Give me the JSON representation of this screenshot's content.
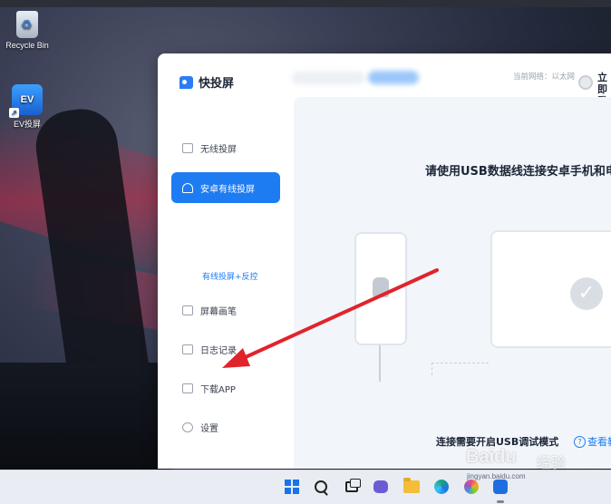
{
  "desktop": {
    "icons": [
      {
        "label": "Recycle Bin",
        "icon": "recycle-bin-icon"
      },
      {
        "label": "EV投屏",
        "icon": "ev-cast-icon"
      }
    ]
  },
  "app": {
    "logo_text": "快投屏",
    "network_label": "当前网络：以太网",
    "login_label": "立即登录",
    "sidebar": {
      "items": [
        {
          "label": "无线投屏",
          "icon": "wireless-cast-icon",
          "active": false
        },
        {
          "label": "安卓有线投屏",
          "icon": "android-icon",
          "active": true
        },
        {
          "label": "屏幕画笔",
          "icon": "pen-icon",
          "active": false
        },
        {
          "label": "日志记录",
          "icon": "log-icon",
          "active": false
        },
        {
          "label": "下载APP",
          "icon": "download-icon",
          "active": false
        },
        {
          "label": "设置",
          "icon": "gear-icon",
          "active": false
        }
      ],
      "sub_link": "有线投屏+反控"
    },
    "main": {
      "title": "请使用USB数据线连接安卓手机和电脑",
      "usb_note": "连接需要开启USB调试模式",
      "usb_link": "查看教程"
    }
  },
  "watermark": {
    "brand": "Baidu",
    "sub": "经验",
    "url": "jingyan.baidu.com"
  },
  "taskbar": {
    "items": [
      "windows-start-icon",
      "search-icon",
      "task-view-icon",
      "chat-icon",
      "file-explorer-icon",
      "edge-icon",
      "photos-icon",
      "ev-cast-icon"
    ]
  },
  "colors": {
    "accent": "#1e7cf2",
    "annotation_arrow": "#e0242c"
  }
}
